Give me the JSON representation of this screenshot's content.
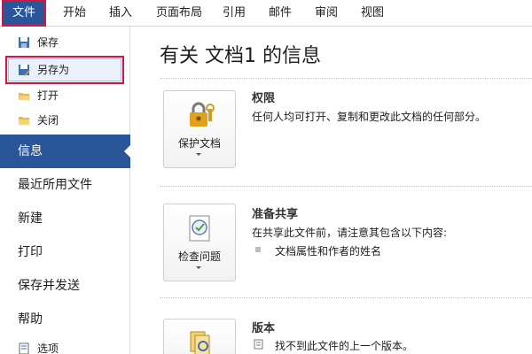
{
  "ribbon": {
    "tabs": [
      "文件",
      "开始",
      "插入",
      "页面布局",
      "引用",
      "邮件",
      "审阅",
      "视图"
    ]
  },
  "left_pane": {
    "commands": [
      {
        "label": "保存",
        "icon": "save-icon"
      },
      {
        "label": "另存为",
        "icon": "save-as-icon"
      },
      {
        "label": "打开",
        "icon": "open-folder-icon"
      },
      {
        "label": "关闭",
        "icon": "close-folder-icon"
      }
    ],
    "nav": [
      "信息",
      "最近所用文件",
      "新建",
      "打印",
      "保存并发送",
      "帮助"
    ],
    "options": {
      "label": "选项",
      "icon": "options-icon"
    }
  },
  "main": {
    "title": "有关 文档1 的信息",
    "permissions": {
      "button_label": "保护文档",
      "heading": "权限",
      "text": "任何人均可打开、复制和更改此文档的任何部分。"
    },
    "prepare": {
      "button_label": "检查问题",
      "heading": "准备共享",
      "text": "在共享此文件前，请注意其包含以下内容:",
      "bullet": "文档属性和作者的姓名"
    },
    "versions": {
      "heading": "版本",
      "text": "找不到此文件的上一个版本。"
    }
  },
  "colors": {
    "accent": "#2a5699",
    "highlight_border": "#d6163e"
  }
}
